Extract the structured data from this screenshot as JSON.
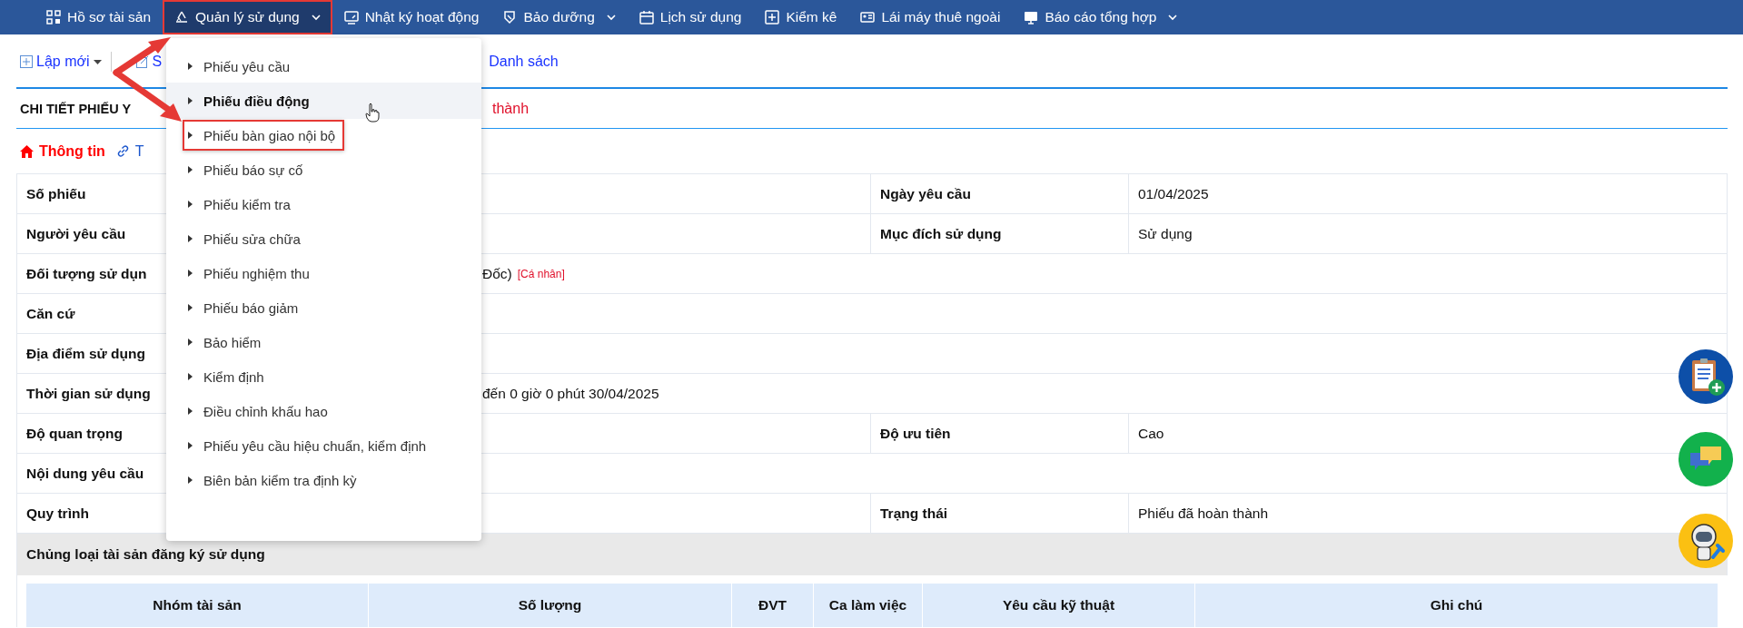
{
  "nav": [
    {
      "label": "Hồ sơ tài sản",
      "dropdown": false,
      "selected": false,
      "highlighted": false
    },
    {
      "label": "Quản lý sử dụng",
      "dropdown": true,
      "selected": true,
      "highlighted": true
    },
    {
      "label": "Nhật ký hoạt động",
      "dropdown": false,
      "selected": false,
      "highlighted": false
    },
    {
      "label": "Bảo dưỡng",
      "dropdown": true,
      "selected": false,
      "highlighted": false
    },
    {
      "label": "Lịch sử dụng",
      "dropdown": false,
      "selected": false,
      "highlighted": false
    },
    {
      "label": "Kiểm kê",
      "dropdown": false,
      "selected": false,
      "highlighted": false
    },
    {
      "label": "Lái máy thuê ngoài",
      "dropdown": false,
      "selected": false,
      "highlighted": false
    },
    {
      "label": "Báo cáo tổng hợp",
      "dropdown": true,
      "selected": false,
      "highlighted": false
    }
  ],
  "toolbar": [
    {
      "label": "Lập mới",
      "dropdown": true
    },
    {
      "label": "S",
      "dropdown": false
    },
    {
      "label": "Danh sách",
      "dropdown": false
    }
  ],
  "title": "CHI TIẾT PHIẾU Y",
  "title_status": "thành",
  "tabs": [
    {
      "label": "Thông tin",
      "selected": true
    },
    {
      "label": "T",
      "selected": false
    }
  ],
  "details": [
    {
      "kind": "pair",
      "label": "Số phiếu",
      "label2": "Ngày yêu cầu",
      "value2": "01/04/2025"
    },
    {
      "kind": "pair",
      "label": "Người yêu cầu",
      "label2": "Mục đích sử dụng",
      "value2": "Sử dụng"
    },
    {
      "kind": "wide",
      "label": "Đối tượng sử dụn",
      "value": "Đốc)",
      "tag": "[Cá nhân]"
    },
    {
      "kind": "wide",
      "label": "Căn cứ"
    },
    {
      "kind": "wide",
      "label": "Địa điểm sử dụng"
    },
    {
      "kind": "wide",
      "label": "Thời gian sử dụng",
      "value": "đến 0 giờ 0 phút 30/04/2025"
    },
    {
      "kind": "pair",
      "label": "Độ quan trọng",
      "label2": "Độ ưu tiên",
      "value2": "Cao"
    },
    {
      "kind": "wide",
      "label": "Nội dung yêu cầu"
    },
    {
      "kind": "pair",
      "label": "Quy trình",
      "label2": "Trạng thái",
      "value2": "Phiếu đã hoàn thành"
    }
  ],
  "section": {
    "title": "Chủng loại tài sản đăng ký sử dụng",
    "columns": [
      "Nhóm tài sản",
      "Số lượng",
      "ĐVT",
      "Ca làm việc",
      "Yêu cầu kỹ thuật",
      "Ghi chú"
    ]
  },
  "menu": [
    {
      "label": "Phiếu yêu cầu",
      "hovered": false,
      "highlighted": false
    },
    {
      "label": "Phiếu điều động",
      "hovered": true,
      "highlighted": false
    },
    {
      "label": "Phiếu bàn giao nội bộ",
      "hovered": false,
      "highlighted": true
    },
    {
      "label": "Phiếu báo sự cố",
      "hovered": false,
      "highlighted": false
    },
    {
      "label": "Phiếu kiểm tra",
      "hovered": false,
      "highlighted": false
    },
    {
      "label": "Phiếu sửa chữa",
      "hovered": false,
      "highlighted": false
    },
    {
      "label": "Phiếu nghiệm thu",
      "hovered": false,
      "highlighted": false
    },
    {
      "label": "Phiếu báo giảm",
      "hovered": false,
      "highlighted": false
    },
    {
      "label": "Bảo hiểm",
      "hovered": false,
      "highlighted": false
    },
    {
      "label": "Kiểm định",
      "hovered": false,
      "highlighted": false
    },
    {
      "label": "Điều chỉnh khấu hao",
      "hovered": false,
      "highlighted": false
    },
    {
      "label": "Phiếu yêu cầu hiệu chuẩn, kiểm định",
      "hovered": false,
      "highlighted": false
    },
    {
      "label": "Biên bản kiểm tra định kỳ",
      "hovered": false,
      "highlighted": false
    }
  ]
}
